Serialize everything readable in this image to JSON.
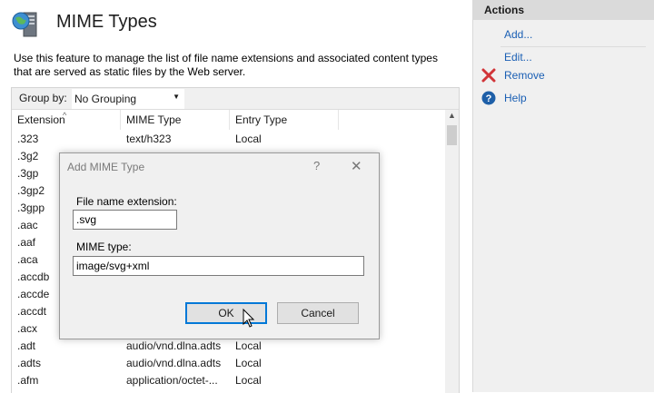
{
  "page": {
    "title": "MIME Types",
    "description": "Use this feature to manage the list of file name extensions and associated content types that are served as static files by the Web server."
  },
  "group_by": {
    "label": "Group by:",
    "value": "No Grouping"
  },
  "columns": {
    "extension": "Extension",
    "mime_type": "MIME Type",
    "entry_type": "Entry Type"
  },
  "rows": [
    {
      "ext": ".323",
      "mime": "text/h323",
      "entry": "Local"
    },
    {
      "ext": ".3g2",
      "mime": "",
      "entry": ""
    },
    {
      "ext": ".3gp",
      "mime": "",
      "entry": ""
    },
    {
      "ext": ".3gp2",
      "mime": "",
      "entry": ""
    },
    {
      "ext": ".3gpp",
      "mime": "",
      "entry": ""
    },
    {
      "ext": ".aac",
      "mime": "",
      "entry": ""
    },
    {
      "ext": ".aaf",
      "mime": "",
      "entry": ""
    },
    {
      "ext": ".aca",
      "mime": "",
      "entry": ""
    },
    {
      "ext": ".accdb",
      "mime": "",
      "entry": ""
    },
    {
      "ext": ".accde",
      "mime": "",
      "entry": ""
    },
    {
      "ext": ".accdt",
      "mime": "",
      "entry": ""
    },
    {
      "ext": ".acx",
      "mime": "",
      "entry": ""
    },
    {
      "ext": ".adt",
      "mime": "audio/vnd.dlna.adts",
      "entry": "Local"
    },
    {
      "ext": ".adts",
      "mime": "audio/vnd.dlna.adts",
      "entry": "Local"
    },
    {
      "ext": ".afm",
      "mime": "application/octet-...",
      "entry": "Local"
    }
  ],
  "actions": {
    "header": "Actions",
    "add": "Add...",
    "edit": "Edit...",
    "remove": "Remove",
    "help": "Help"
  },
  "dialog": {
    "title": "Add MIME Type",
    "help_glyph": "?",
    "close_glyph": "✕",
    "ext_label": "File name extension:",
    "ext_value": ".svg",
    "mime_label": "MIME type:",
    "mime_value": "image/svg+xml",
    "ok_label": "OK",
    "cancel_label": "Cancel"
  },
  "colors": {
    "link": "#1a5fb4",
    "remove_icon": "#d13438",
    "help_icon": "#1e5fa8",
    "ok_border": "#0078d7"
  },
  "icons": [
    "server-globe-icon",
    "remove-x-icon",
    "help-icon",
    "mouse-cursor-icon"
  ]
}
